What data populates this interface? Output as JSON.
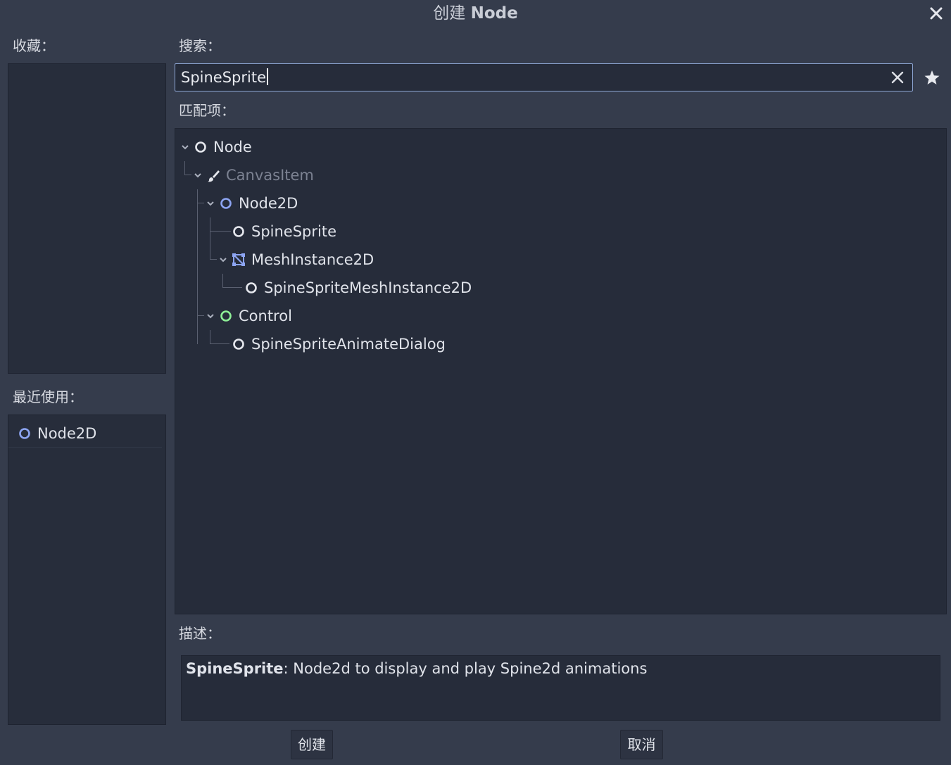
{
  "dialog": {
    "title_prefix": "创建",
    "title_bold": "Node"
  },
  "favorites": {
    "label": "收藏："
  },
  "recent": {
    "label": "最近使用：",
    "items": [
      {
        "label": "Node2D",
        "icon": "node2d-circle-icon"
      }
    ]
  },
  "search": {
    "label": "搜索：",
    "value": "SpineSprite"
  },
  "matches": {
    "label": "匹配项：",
    "tree": [
      {
        "label": "Node",
        "icon": "node-circle-icon",
        "expanded": true,
        "dim": false
      },
      {
        "label": "CanvasItem",
        "icon": "brush-icon",
        "expanded": true,
        "dim": true
      },
      {
        "label": "Node2D",
        "icon": "node2d-circle-icon",
        "expanded": true,
        "dim": false
      },
      {
        "label": "SpineSprite",
        "icon": "node-circle-icon",
        "selected": true,
        "dim": false
      },
      {
        "label": "MeshInstance2D",
        "icon": "mesh-instance-icon",
        "expanded": true,
        "dim": false
      },
      {
        "label": "SpineSpriteMeshInstance2D",
        "icon": "node-circle-icon",
        "dim": false
      },
      {
        "label": "Control",
        "icon": "control-circle-icon",
        "expanded": true,
        "dim": false
      },
      {
        "label": "SpineSpriteAnimateDialog",
        "icon": "node-circle-icon",
        "dim": false
      }
    ]
  },
  "description": {
    "label": "描述：",
    "name": "SpineSprite",
    "text": ": Node2d to display and play Spine2d animations"
  },
  "buttons": {
    "create": "创建",
    "cancel": "取消"
  },
  "colors": {
    "background": "#353c4c",
    "panel": "#262c3a",
    "selected": "#4f5563",
    "node2d_blue": "#8da5f3",
    "control_green": "#8eef97",
    "focus_border": "#8ea6d4"
  }
}
